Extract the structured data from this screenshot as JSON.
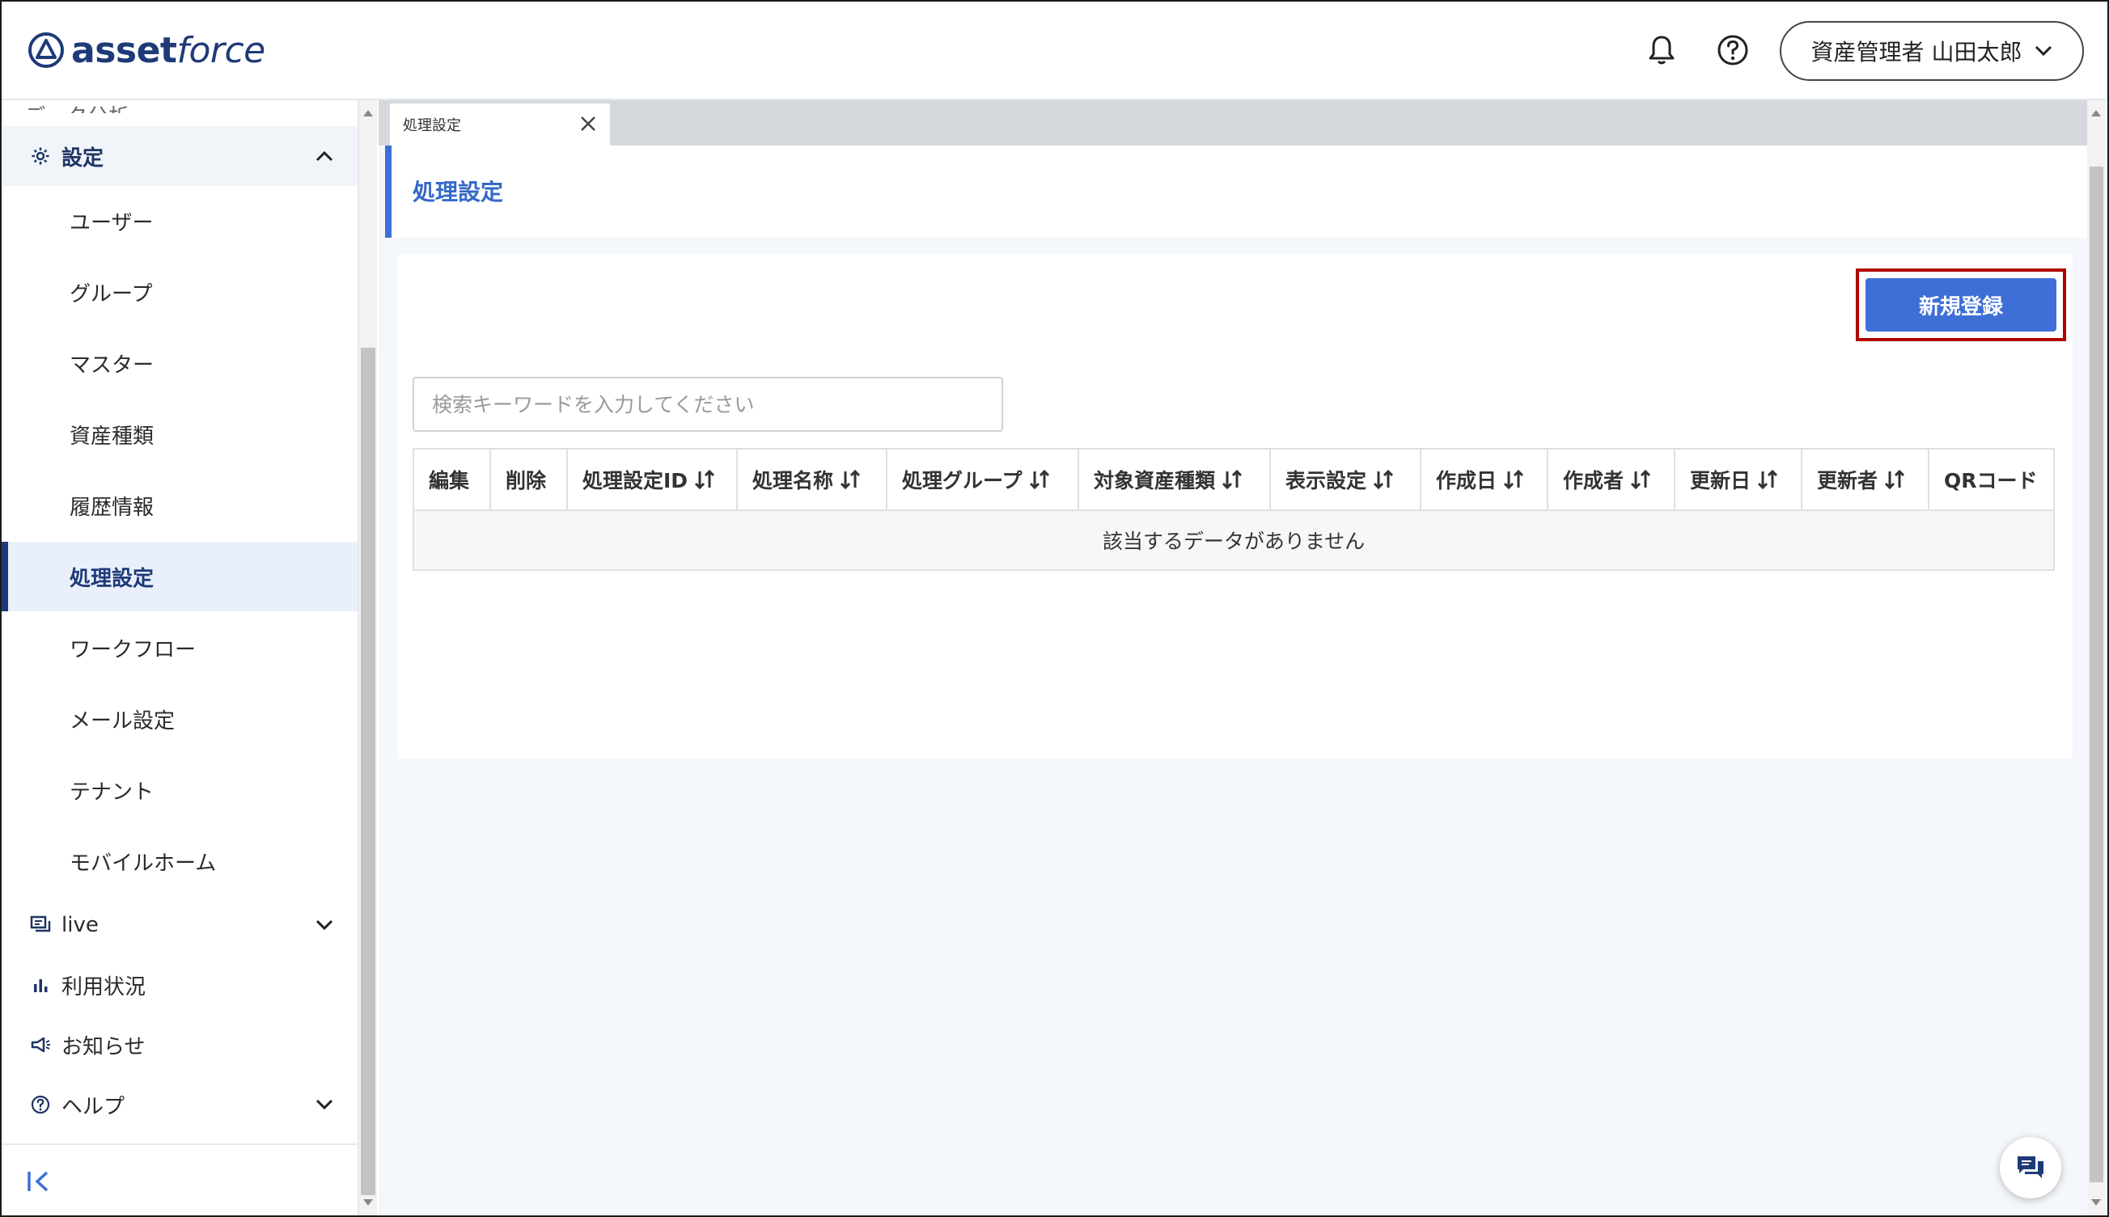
{
  "header": {
    "logo_text_bold": "asset",
    "logo_text_italic": "force",
    "user_menu_label": "資産管理者 山田太郎"
  },
  "sidebar": {
    "cut_item_label": "データ分析",
    "settings_label": "設定",
    "settings_subitems": [
      {
        "label": "ユーザー"
      },
      {
        "label": "グループ"
      },
      {
        "label": "マスター"
      },
      {
        "label": "資産種類"
      },
      {
        "label": "履歴情報"
      },
      {
        "label": "処理設定",
        "active": true
      },
      {
        "label": "ワークフロー"
      },
      {
        "label": "メール設定"
      },
      {
        "label": "テナント"
      },
      {
        "label": "モバイルホーム"
      }
    ],
    "top_items": [
      {
        "label": "live",
        "icon": "chat-icon"
      },
      {
        "label": "利用状況",
        "icon": "bar-chart-icon"
      },
      {
        "label": "お知らせ",
        "icon": "megaphone-icon"
      },
      {
        "label": "ヘルプ",
        "icon": "help-circle-icon"
      }
    ]
  },
  "tabs": [
    {
      "label": "処理設定"
    }
  ],
  "page": {
    "title": "処理設定",
    "new_button_label": "新規登録",
    "search_placeholder": "検索キーワードを入力してください"
  },
  "table": {
    "columns": [
      {
        "label": "編集",
        "sortable": false
      },
      {
        "label": "削除",
        "sortable": false
      },
      {
        "label": "処理設定ID",
        "sortable": true
      },
      {
        "label": "処理名称",
        "sortable": true
      },
      {
        "label": "処理グループ",
        "sortable": true
      },
      {
        "label": "対象資産種類",
        "sortable": true
      },
      {
        "label": "表示設定",
        "sortable": true
      },
      {
        "label": "作成日",
        "sortable": true
      },
      {
        "label": "作成者",
        "sortable": true
      },
      {
        "label": "更新日",
        "sortable": true
      },
      {
        "label": "更新者",
        "sortable": true
      },
      {
        "label": "QRコード",
        "sortable": false
      }
    ],
    "empty_message": "該当するデータがありません"
  },
  "colors": {
    "brand": "#1e3a78",
    "accent": "#3d6fd6",
    "highlight_border": "#b00000"
  }
}
